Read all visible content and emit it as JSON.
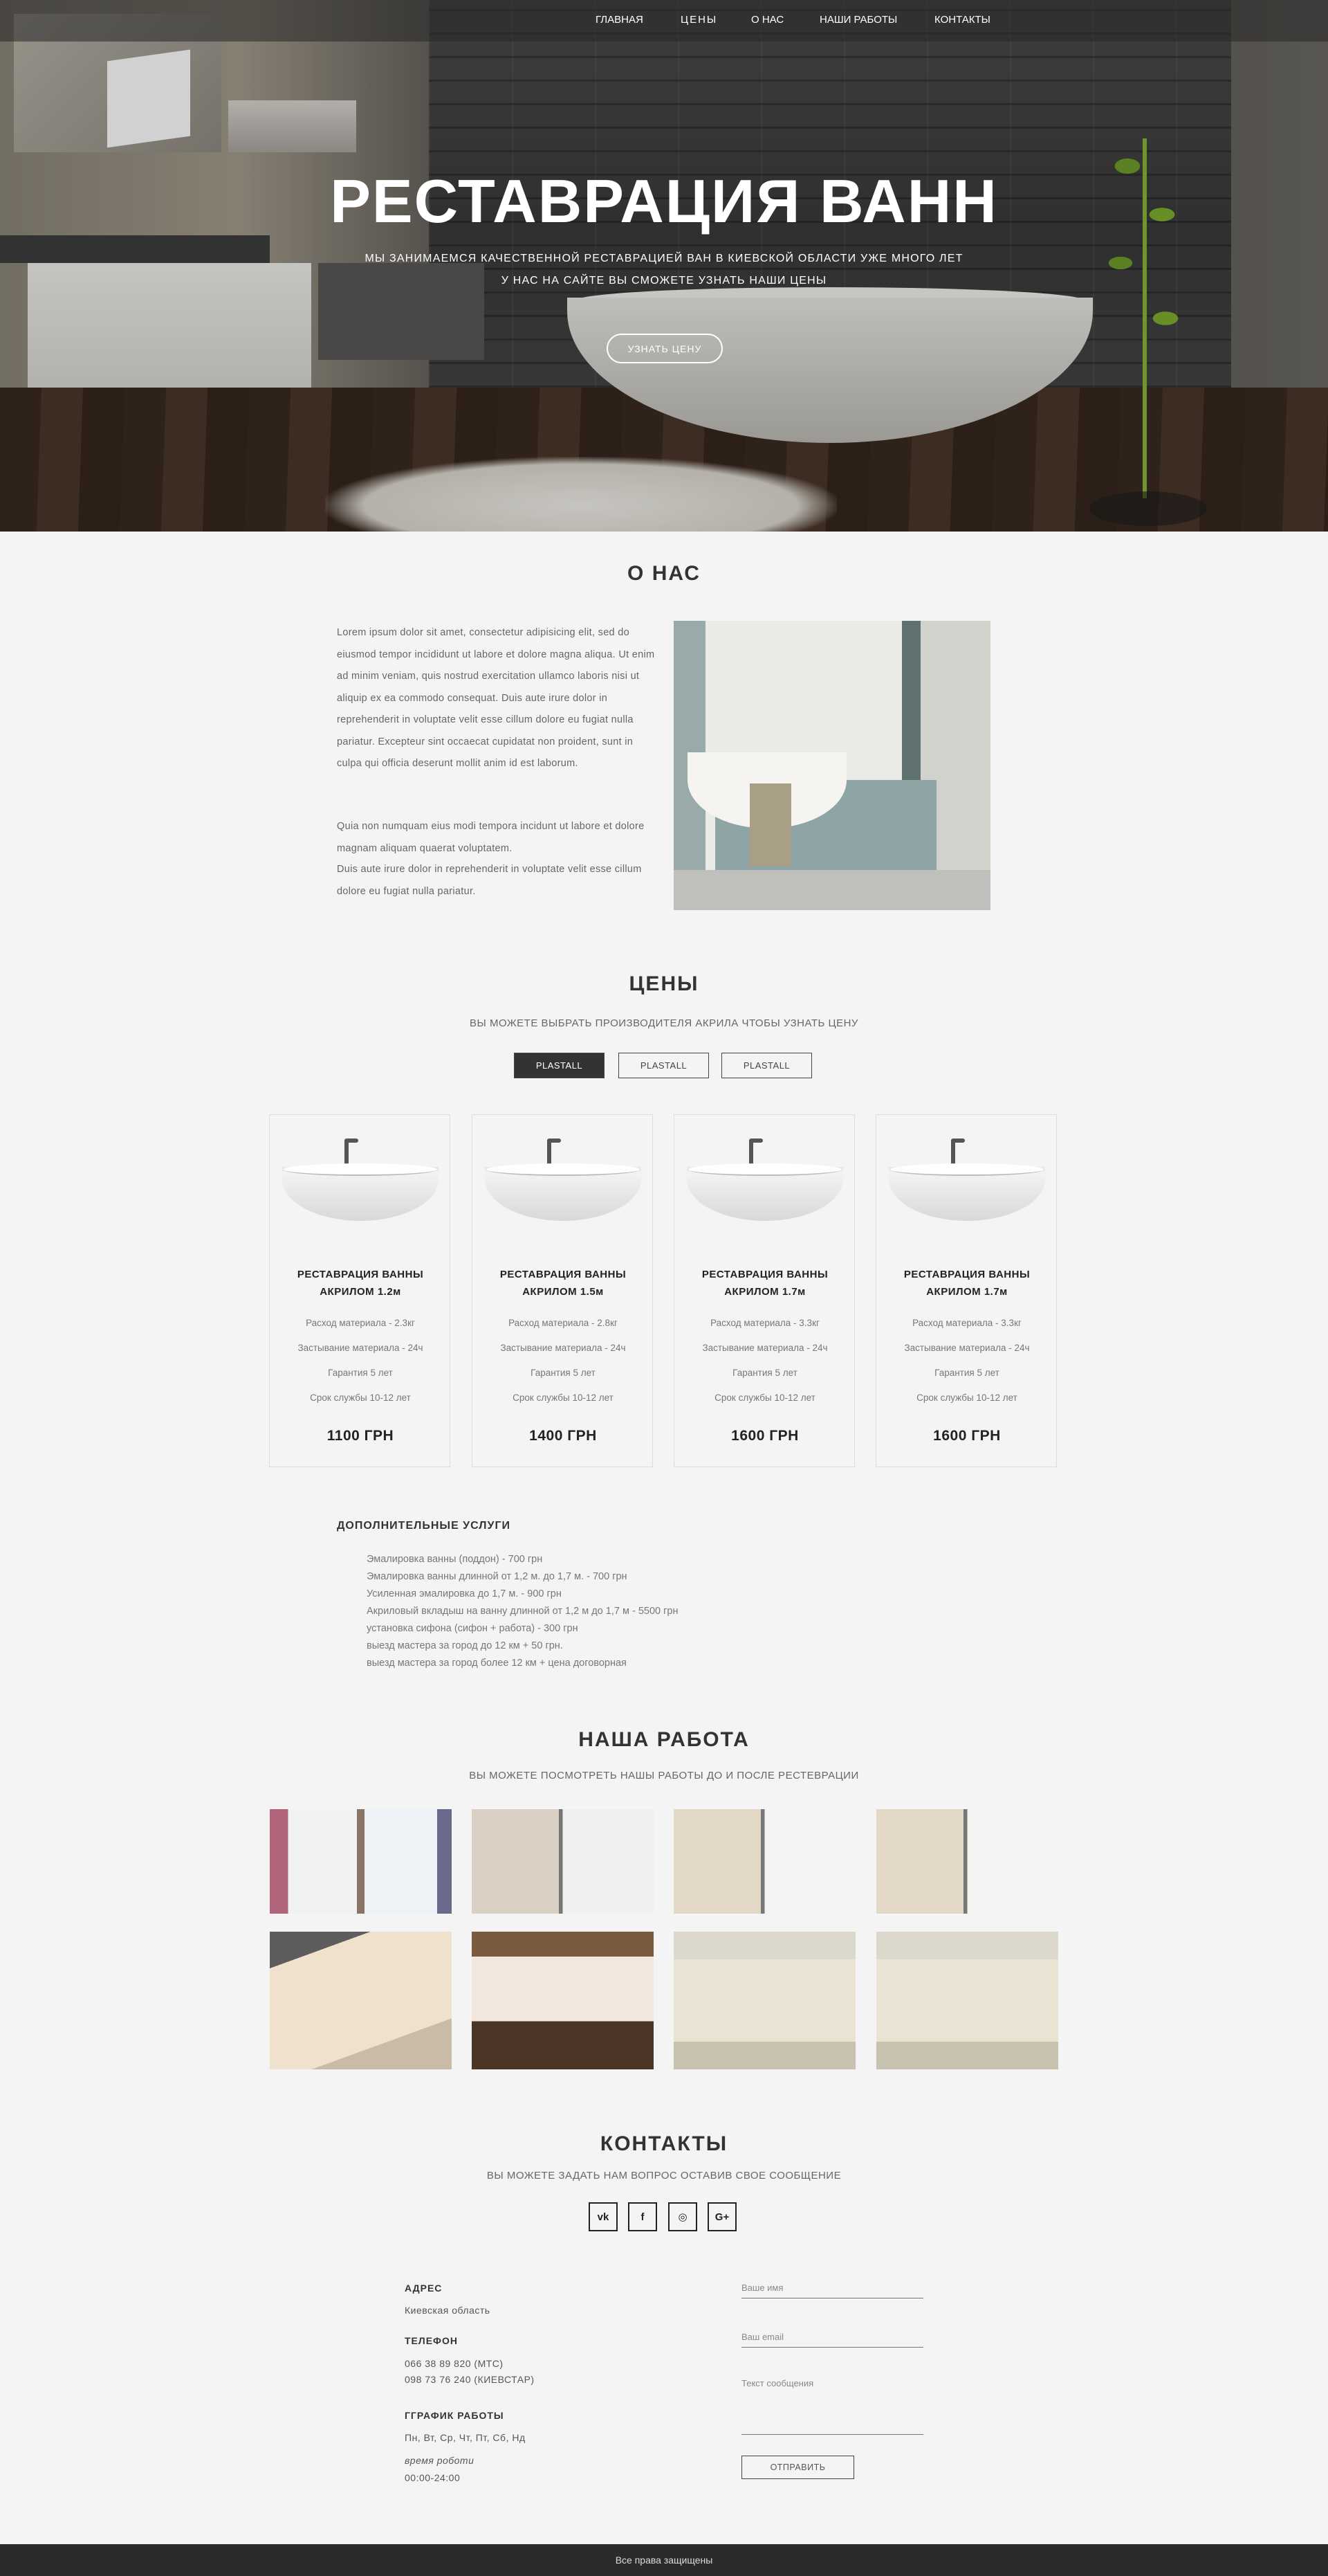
{
  "nav": {
    "items": [
      "ГЛАВНАЯ",
      "ЦЕНЫ",
      "О НАС",
      "НАШИ РАБОТЫ",
      "КОНТАКТЫ"
    ]
  },
  "hero": {
    "title": "РЕСТАВРАЦИЯ ВАНН",
    "line1": "МЫ ЗАНИМАЕМСЯ КАЧЕСТВЕННОЙ РЕСТАВРАЦИЕЙ ВАН В КИЕВСКОЙ ОБЛАСТИ УЖЕ МНОГО ЛЕТ",
    "line2": "У НАС НА САЙТЕ ВЫ СМОЖЕТЕ УЗНАТЬ НАШИ ЦЕНЫ",
    "button": "УЗНАТЬ ЦЕНУ"
  },
  "about": {
    "title": "О НАС",
    "paragraph1": "Lorem ipsum dolor sit amet, consectetur adipisicing elit, sed do eiusmod tempor incididunt ut labore et dolore magna aliqua. Ut enim ad minim veniam, quis nostrud exercitation ullamco laboris nisi ut aliquip ex ea commodo consequat. Duis aute irure dolor in reprehenderit in voluptate velit esse cillum dolore eu fugiat nulla pariatur. Excepteur sint occaecat cupidatat non proident, sunt in culpa qui officia deserunt mollit anim id est laborum.",
    "paragraph2": "Quia non numquam eius modi tempora incidunt ut labore et dolore magnam aliquam quaerat voluptatem.",
    "paragraph3": "Duis aute irure dolor in reprehenderit in voluptate velit esse cillum dolore eu fugiat nulla pariatur."
  },
  "prices": {
    "title": "ЦЕНЫ",
    "subtitle": "ВЫ МОЖЕТЕ ВЫБРАТЬ ПРОИЗВОДИТЕЛЯ АКРИЛА ЧТОБЫ УЗНАТЬ ЦЕНУ",
    "filters": [
      "PLASTALL",
      "PLASTALL",
      "PLASTALL"
    ],
    "cards": [
      {
        "name1": "РЕСТАВРАЦИЯ ВАННЫ",
        "name2": "АКРИЛОМ 1.2м",
        "usage": "Расход материала - 2.3кг",
        "cure": "Застывание материала - 24ч",
        "warranty": "Гарантия 5 лет",
        "life": "Срок службы 10-12 лет",
        "price": "1100 ГРН"
      },
      {
        "name1": "РЕСТАВРАЦИЯ ВАННЫ",
        "name2": "АКРИЛОМ 1.5м",
        "usage": "Расход материала - 2.8кг",
        "cure": "Застывание материала - 24ч",
        "warranty": "Гарантия 5 лет",
        "life": "Срок службы 10-12 лет",
        "price": "1400 ГРН"
      },
      {
        "name1": "РЕСТАВРАЦИЯ ВАННЫ",
        "name2": "АКРИЛОМ 1.7м",
        "usage": "Расход материала - 3.3кг",
        "cure": "Застывание материала - 24ч",
        "warranty": "Гарантия 5 лет",
        "life": "Срок службы 10-12 лет",
        "price": "1600 ГРН"
      },
      {
        "name1": "РЕСТАВРАЦИЯ ВАННЫ",
        "name2": "АКРИЛОМ 1.7м",
        "usage": "Расход материала - 3.3кг",
        "cure": "Застывание материала - 24ч",
        "warranty": "Гарантия 5 лет",
        "life": "Срок службы 10-12 лет",
        "price": "1600 ГРН"
      }
    ]
  },
  "extra": {
    "title": "ДОПОЛНИТЕЛЬНЫЕ УСЛУГИ",
    "items": [
      "Эмалировка ванны (поддон) - 700 грн",
      "Эмалировка ванны длинной от 1,2 м. до 1,7 м. - 700 грн",
      "Усиленная эмалировка до 1,7 м. - 900 грн",
      "Акриловый вкладыш на ванну длинной от 1,2 м до 1,7 м - 5500 грн",
      "установка сифона (сифон + работа) - 300 грн",
      "выезд мастера за город до 12 км + 50 грн.",
      "выезд мастера за город более 12 км + цена договорная"
    ]
  },
  "works": {
    "title": "НАША РАБОТА",
    "subtitle": "ВЫ МОЖЕТЕ ПОСМОТРЕТЬ НАШЫ РАБОТЫ ДО И ПОСЛЕ РЕСТЕВРАЦИИ"
  },
  "contacts": {
    "title": "КОНТАКТЫ",
    "subtitle": "ВЫ МОЖЕТЕ ЗАДАТЬ НАМ ВОПРОС ОСТАВИВ СВОЕ СООБЩЕНИЕ",
    "social": [
      "vk",
      "f",
      "◎",
      "G+"
    ],
    "address_label": "АДРЕС",
    "address": "Киевская область",
    "phone_label": "ТЕЛЕФОН",
    "phone1": "066 38 89 820  (МТС)",
    "phone2": "098 73 76 240  (КИЕВСТАР)",
    "schedule_label": "ГГРАФИК РАБОТЫ",
    "days": "Пн, Вт, Ср, Чт, Пт, Сб, Нд",
    "time_label": "время роботи",
    "hours": "00:00-24:00",
    "name_placeholder": "Ваше имя",
    "email_placeholder": "Ваш email",
    "message_placeholder": "Текст сообщения",
    "send": "ОТПРАВИТЬ"
  },
  "footer": {
    "text": "Все права защищены"
  }
}
